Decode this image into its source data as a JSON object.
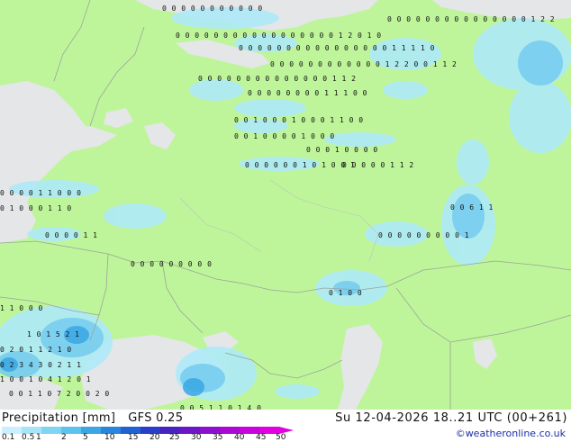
{
  "footer": {
    "title_label": "Precipitation [mm]",
    "model": "GFS 0.25",
    "datetime": "Su 12-04-2026 18..21 UTC (00+261)",
    "credit": "©weatheronline.co.uk"
  },
  "legend": {
    "ticks": [
      "0.1",
      "0.5",
      "1",
      "2",
      "5",
      "10",
      "15",
      "20",
      "25",
      "30",
      "35",
      "40",
      "45",
      "50"
    ],
    "colors": [
      "#c8f0ff",
      "#a6e4f8",
      "#80d6f2",
      "#5cc4ec",
      "#3aa7e4",
      "#2a86dc",
      "#1f62d0",
      "#2a3fc8",
      "#4a22c0",
      "#6c16c6",
      "#8c10cc",
      "#ac08d4",
      "#c804dc",
      "#e000e0"
    ]
  },
  "map": {
    "land_color": "#bff59a",
    "sea_color": "#e4e6e8",
    "precip_light": "#aeeaf8",
    "precip_medium": "#78cdee",
    "precip_heavy": "#3aa7e4",
    "value_rows": [
      {
        "text": "0 0 0   0 0 0   0   0   0     0 0"
      },
      {
        "text": "0 0 0   0 0 0   0 0   0   0 0   0 0 0 0      1 2 2"
      },
      {
        "text": "0 0 0   0 0 0 0   0 0   0 0 0 0    0 0 0 0   1 2 0 1 0"
      },
      {
        "text": "0 0 0   0 0 0   0 0 0 0 0   0 0 0 0   0 1 1 1 1 0"
      },
      {
        "text": "0 0 0 0 0 0   0 0 0   0 0   0 1 2 2 0 0 1 1 2"
      },
      {
        "text": "0 0 0   0   0   0 0 0   0 0 0 0 0 0 1 1 2"
      },
      {
        "text": "0 0 0 0   0   0   0     0   1 1 1 0 0"
      },
      {
        "text": "0 0 1 0   0 0 1 0 0   0 1 1 0 0"
      },
      {
        "text": "0 0 1   0 0 0   0   1 0 0 0"
      },
      {
        "text": "0 0 0 1   0 0 0   0"
      },
      {
        "text": "0 0   0   0   0   1 1 2"
      },
      {
        "text": "0 0 0 0 1 1 0   0   0"
      },
      {
        "text": "0 0 0 0 0 0 1 0   1 0 0 1"
      },
      {
        "text": "0 0 6 1 1"
      },
      {
        "text": "0   1 0   0 0 1 1 0"
      },
      {
        "text": "0 0 0   0   0 0 0 0 0 1"
      },
      {
        "text": "0 0 0   0 1 1"
      },
      {
        "text": "0   0 0 0   0 0   0 0 0"
      },
      {
        "text": "0 1 0 0"
      },
      {
        "text": "1 1   0 0 0"
      },
      {
        "text": "1 0 1 5 2 1"
      },
      {
        "text": "0 2 0 1 1 2   1 0"
      },
      {
        "text": "0 2 3 4 3 0   2 1 1"
      },
      {
        "text": "1 0 0 1 0   4 1 2 0   1"
      },
      {
        "text": "0 0 1   1 0   7 2 0   0 2 0"
      },
      {
        "text": "0 0 5   1 1 0 1 4 0"
      }
    ]
  }
}
